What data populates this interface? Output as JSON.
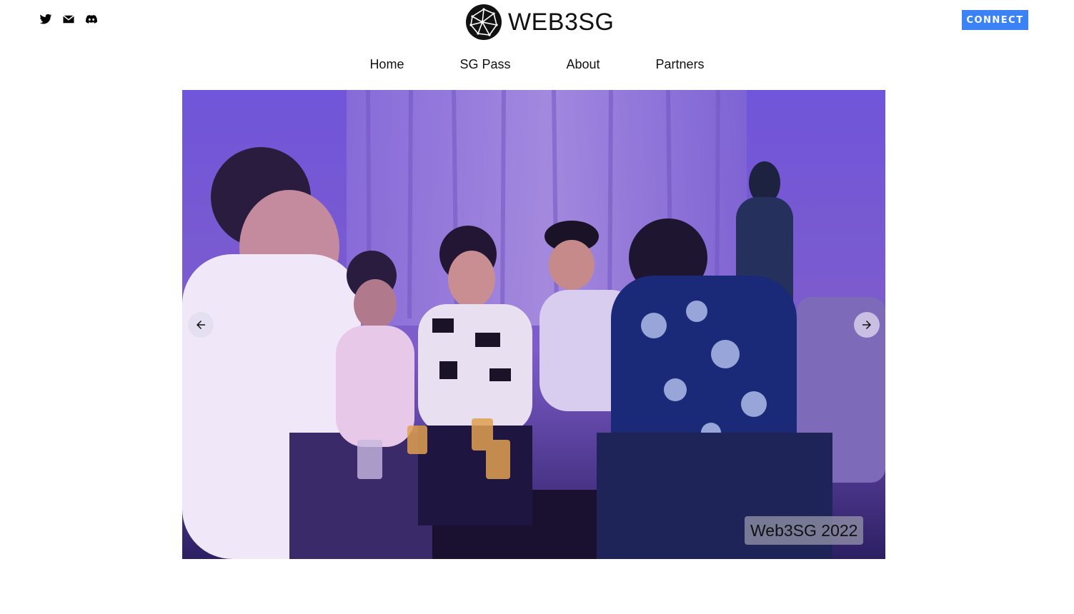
{
  "header": {
    "social_icons": [
      "twitter-icon",
      "mail-icon",
      "discord-icon"
    ],
    "logo_text": "WEB3SG",
    "connect_label": "CONNECT",
    "connect_color": "#3b82f6"
  },
  "nav": {
    "items": [
      {
        "label": "Home"
      },
      {
        "label": "SG Pass"
      },
      {
        "label": "About"
      },
      {
        "label": "Partners"
      }
    ]
  },
  "carousel": {
    "caption": "Web3SG 2022",
    "prev_icon": "arrow-left-icon",
    "next_icon": "arrow-right-icon",
    "photo_tint": "#6b4fd8"
  }
}
